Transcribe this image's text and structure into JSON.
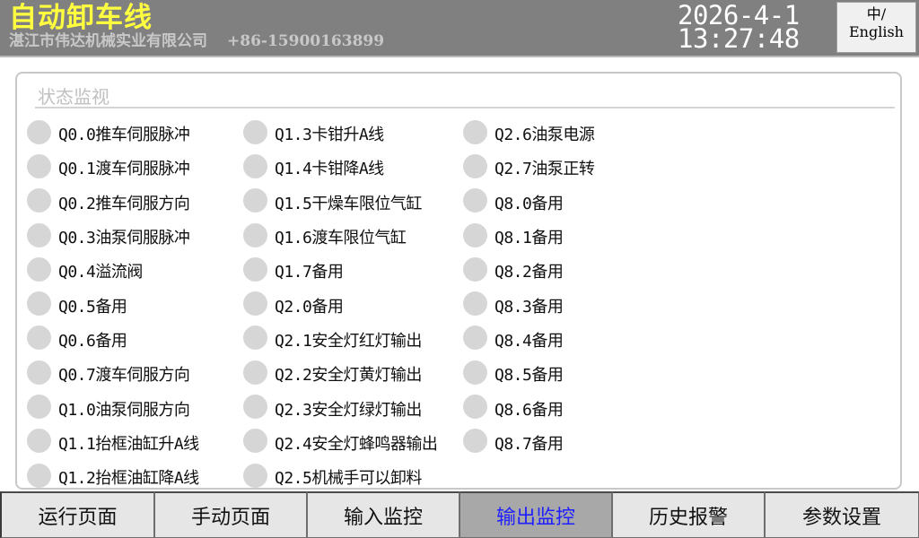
{
  "header": {
    "title": "自动卸车线",
    "company": "湛江市伟达机械实业有限公司",
    "phone": "+86-15900163899",
    "date": "2026-4-1",
    "time": "13:27:48",
    "lang_line1": "中/",
    "lang_line2": "English"
  },
  "panel": {
    "title": "状态监视"
  },
  "indicators": {
    "col1": [
      "Q0.0推车伺服脉冲",
      "Q0.1渡车伺服脉冲",
      "Q0.2推车伺服方向",
      "Q0.3油泵伺服脉冲",
      "Q0.4溢流阀",
      "Q0.5备用",
      "Q0.6备用",
      "Q0.7渡车伺服方向",
      "Q1.0油泵伺服方向",
      "Q1.1抬框油缸升A线",
      "Q1.2抬框油缸降A线"
    ],
    "col2": [
      "Q1.3卡钳升A线",
      "Q1.4卡钳降A线",
      "Q1.5干燥车限位气缸",
      "Q1.6渡车限位气缸",
      "Q1.7备用",
      "Q2.0备用",
      "Q2.1安全灯红灯输出",
      "Q2.2安全灯黄灯输出",
      "Q2.3安全灯绿灯输出",
      "Q2.4安全灯蜂鸣器输出",
      "Q2.5机械手可以卸料"
    ],
    "col3": [
      "Q2.6油泵电源",
      "Q2.7油泵正转",
      "Q8.0备用",
      "Q8.1备用",
      "Q8.2备用",
      "Q8.3备用",
      "Q8.4备用",
      "Q8.5备用",
      "Q8.6备用",
      "Q8.7备用"
    ],
    "led_off_color": "#d6d6d6"
  },
  "nav": [
    {
      "label": "运行页面",
      "active": false
    },
    {
      "label": "手动页面",
      "active": false
    },
    {
      "label": "输入监控",
      "active": false
    },
    {
      "label": "输出监控",
      "active": true
    },
    {
      "label": "历史报警",
      "active": false
    },
    {
      "label": "参数设置",
      "active": false
    }
  ],
  "colors": {
    "title": "#ffff40",
    "header_bg": "#808080",
    "active_nav_text": "#2020ff"
  }
}
